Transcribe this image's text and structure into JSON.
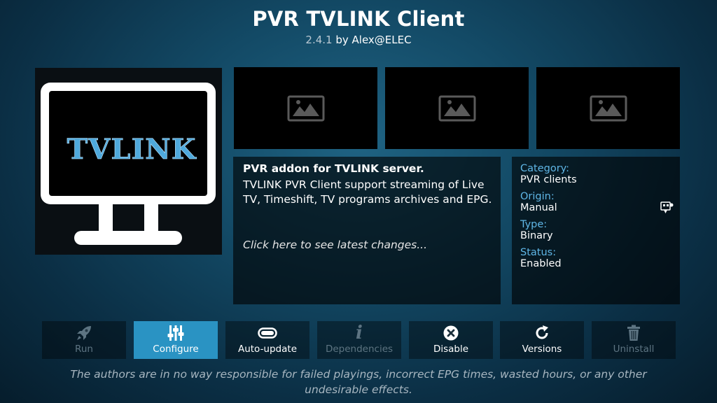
{
  "header": {
    "title": "PVR TVLINK Client",
    "version": "2.4.1",
    "by_text": "by Alex@ELEC"
  },
  "icon": {
    "logo_text": "TVLINK"
  },
  "screenshots": [
    {
      "icon": "image-placeholder-icon"
    },
    {
      "icon": "image-placeholder-icon"
    },
    {
      "icon": "image-placeholder-icon"
    }
  ],
  "description": {
    "heading": "PVR addon for TVLINK server.",
    "body": "TVLINK PVR Client support streaming of Live TV, Timeshift, TV programs archives and EPG.",
    "changes_link": "Click here to see latest changes..."
  },
  "info": {
    "category_label": "Category:",
    "category_value": "PVR clients",
    "origin_label": "Origin:",
    "origin_value": "Manual",
    "type_label": "Type:",
    "type_value": "Binary",
    "status_label": "Status:",
    "status_value": "Enabled"
  },
  "buttons": [
    {
      "label": "Run",
      "icon": "rocket-icon",
      "enabled": false
    },
    {
      "label": "Configure",
      "icon": "sliders-icon",
      "enabled": true,
      "focused": true
    },
    {
      "label": "Auto-update",
      "icon": "toggle-icon",
      "enabled": true
    },
    {
      "label": "Dependencies",
      "icon": "info-icon",
      "enabled": false
    },
    {
      "label": "Disable",
      "icon": "x-circle-icon",
      "enabled": true
    },
    {
      "label": "Versions",
      "icon": "refresh-icon",
      "enabled": true
    },
    {
      "label": "Uninstall",
      "icon": "trash-icon",
      "enabled": false
    }
  ],
  "disclaimer": "The authors are in no way responsible for failed playings, incorrect EPG times, wasted hours, or any other undesirable effects.",
  "colors": {
    "accent": "#2a93c3",
    "label_blue": "#5fb6e6",
    "logo_blue": "#4fa9dc"
  }
}
